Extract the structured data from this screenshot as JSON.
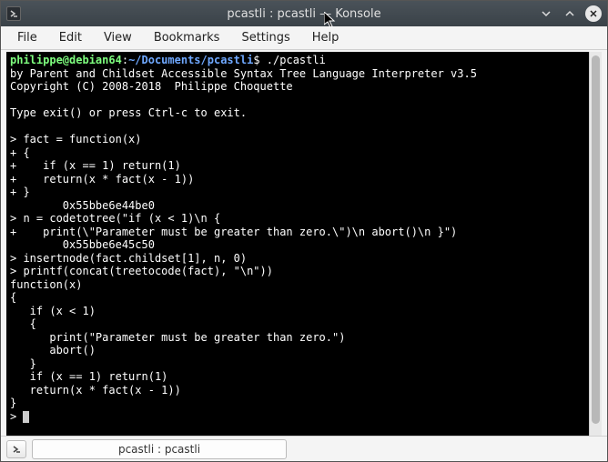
{
  "window": {
    "title": "pcastli : pcastli — Konsole"
  },
  "menu": {
    "items": [
      "File",
      "Edit",
      "View",
      "Bookmarks",
      "Settings",
      "Help"
    ]
  },
  "prompt": {
    "user_host": "philippe@debian64",
    "path": "~/Documents/pcastli",
    "command": "./pcastli"
  },
  "terminal_lines": [
    "by Parent and Childset Accessible Syntax Tree Language Interpreter v3.5",
    "Copyright (C) 2008-2018  Philippe Choquette",
    "",
    "Type exit() or press Ctrl-c to exit.",
    "",
    "> fact = function(x)",
    "+ {",
    "+    if (x == 1) return(1)",
    "+    return(x * fact(x - 1))",
    "+ }",
    "        0x55bbe6e44be0",
    "> n = codetotree(\"if (x < 1)\\n {",
    "+    print(\\\"Parameter must be greater than zero.\\\")\\n abort()\\n }\")",
    "        0x55bbe6e45c50",
    "> insertnode(fact.childset[1], n, 0)",
    "> printf(concat(treetocode(fact), \"\\n\"))",
    "function(x)",
    "{",
    "   if (x < 1)",
    "   {",
    "      print(\"Parameter must be greater than zero.\")",
    "      abort()",
    "   }",
    "   if (x == 1) return(1)",
    "   return(x * fact(x - 1))",
    "}",
    "> "
  ],
  "tab": {
    "label": "pcastli : pcastli"
  }
}
